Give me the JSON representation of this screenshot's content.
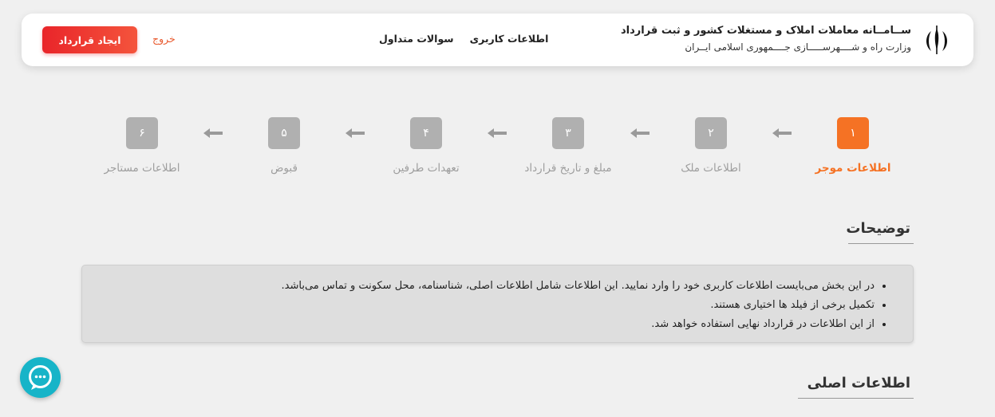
{
  "header": {
    "title": "ســامــانه معاملات املاک و مستغلات کشور و ثبت قرارداد",
    "subtitle": "وزارت راه و شــــهرســـــازی جــــمهوری اسلامی ایــران",
    "nav": [
      "اطلاعات کاربری",
      "سوالات متداول"
    ],
    "exit_label": "خروج",
    "create_contract_label": "ایجاد قرارداد",
    "emblem_icon": "iran-emblem-icon"
  },
  "steps": [
    {
      "number": "۱",
      "label": "اطلاعات موجر",
      "active": true
    },
    {
      "number": "۲",
      "label": "اطلاعات ملک",
      "active": false
    },
    {
      "number": "۳",
      "label": "مبلغ و تاریخ قرارداد",
      "active": false
    },
    {
      "number": "۴",
      "label": "تعهدات طرفین",
      "active": false
    },
    {
      "number": "۵",
      "label": "قبوض",
      "active": false
    },
    {
      "number": "۶",
      "label": "اطلاعات مستاجر",
      "active": false
    }
  ],
  "description": {
    "title": "توضیحات",
    "items": [
      "در این بخش می‌بایست اطلاعات کاربری خود را وارد نمایید. این اطلاعات شامل اطلاعات اصلی، شناسنامه، محل سکونت و تماس می‌باشد.",
      "تکمیل برخی از فیلد ها اختیاری هستند.",
      "از این اطلاعات در قرارداد نهایی استفاده خواهد شد."
    ]
  },
  "main_info": {
    "title": "اطلاعات اصلی"
  },
  "colors": {
    "accent": "#f57224",
    "button_red": "#e9252a",
    "inactive_step": "#b0b0b0",
    "chat_button": "#17b4c8"
  },
  "chat": {
    "icon": "chat-bubble-icon"
  }
}
